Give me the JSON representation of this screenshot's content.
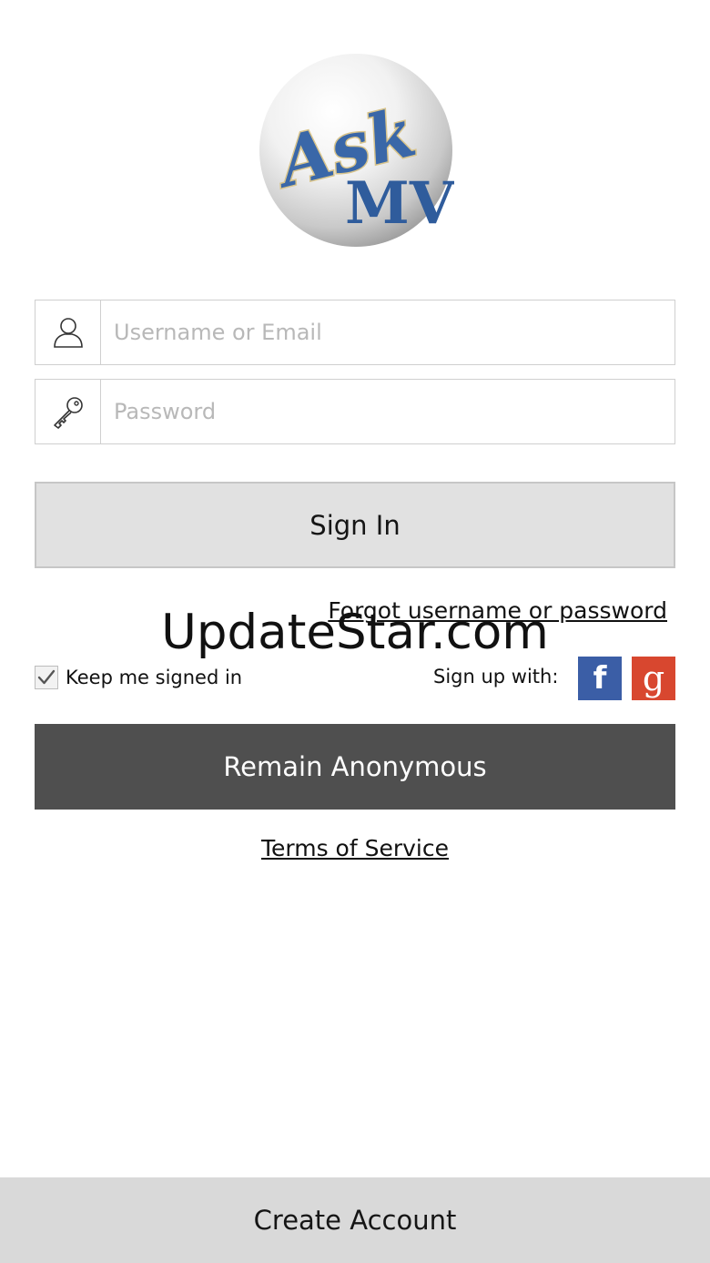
{
  "logo": {
    "line1": "Ask",
    "line2": "MV",
    "icon": "ask-mv-logo"
  },
  "login": {
    "username_placeholder": "Username or Email",
    "username_value": "",
    "username_icon": "user-icon",
    "password_placeholder": "Password",
    "password_value": "",
    "password_icon": "key-icon",
    "signin_label": "Sign In",
    "forgot_label": "Forgot username or password"
  },
  "watermark": "UpdateStar.com",
  "options": {
    "keep_signed_in_label": "Keep me signed in",
    "keep_signed_in_checked": true,
    "signup_label": "Sign up with:",
    "facebook_glyph": "f",
    "google_glyph": "g"
  },
  "actions": {
    "anonymous_label": "Remain Anonymous",
    "terms_label": "Terms of Service",
    "create_account_label": "Create Account"
  },
  "colors": {
    "signin_bg": "#e1e1e1",
    "anonymous_bg": "#4f4f4f",
    "create_bg": "#d9d9d9",
    "facebook": "#3b5ea6",
    "google": "#d8472f"
  }
}
